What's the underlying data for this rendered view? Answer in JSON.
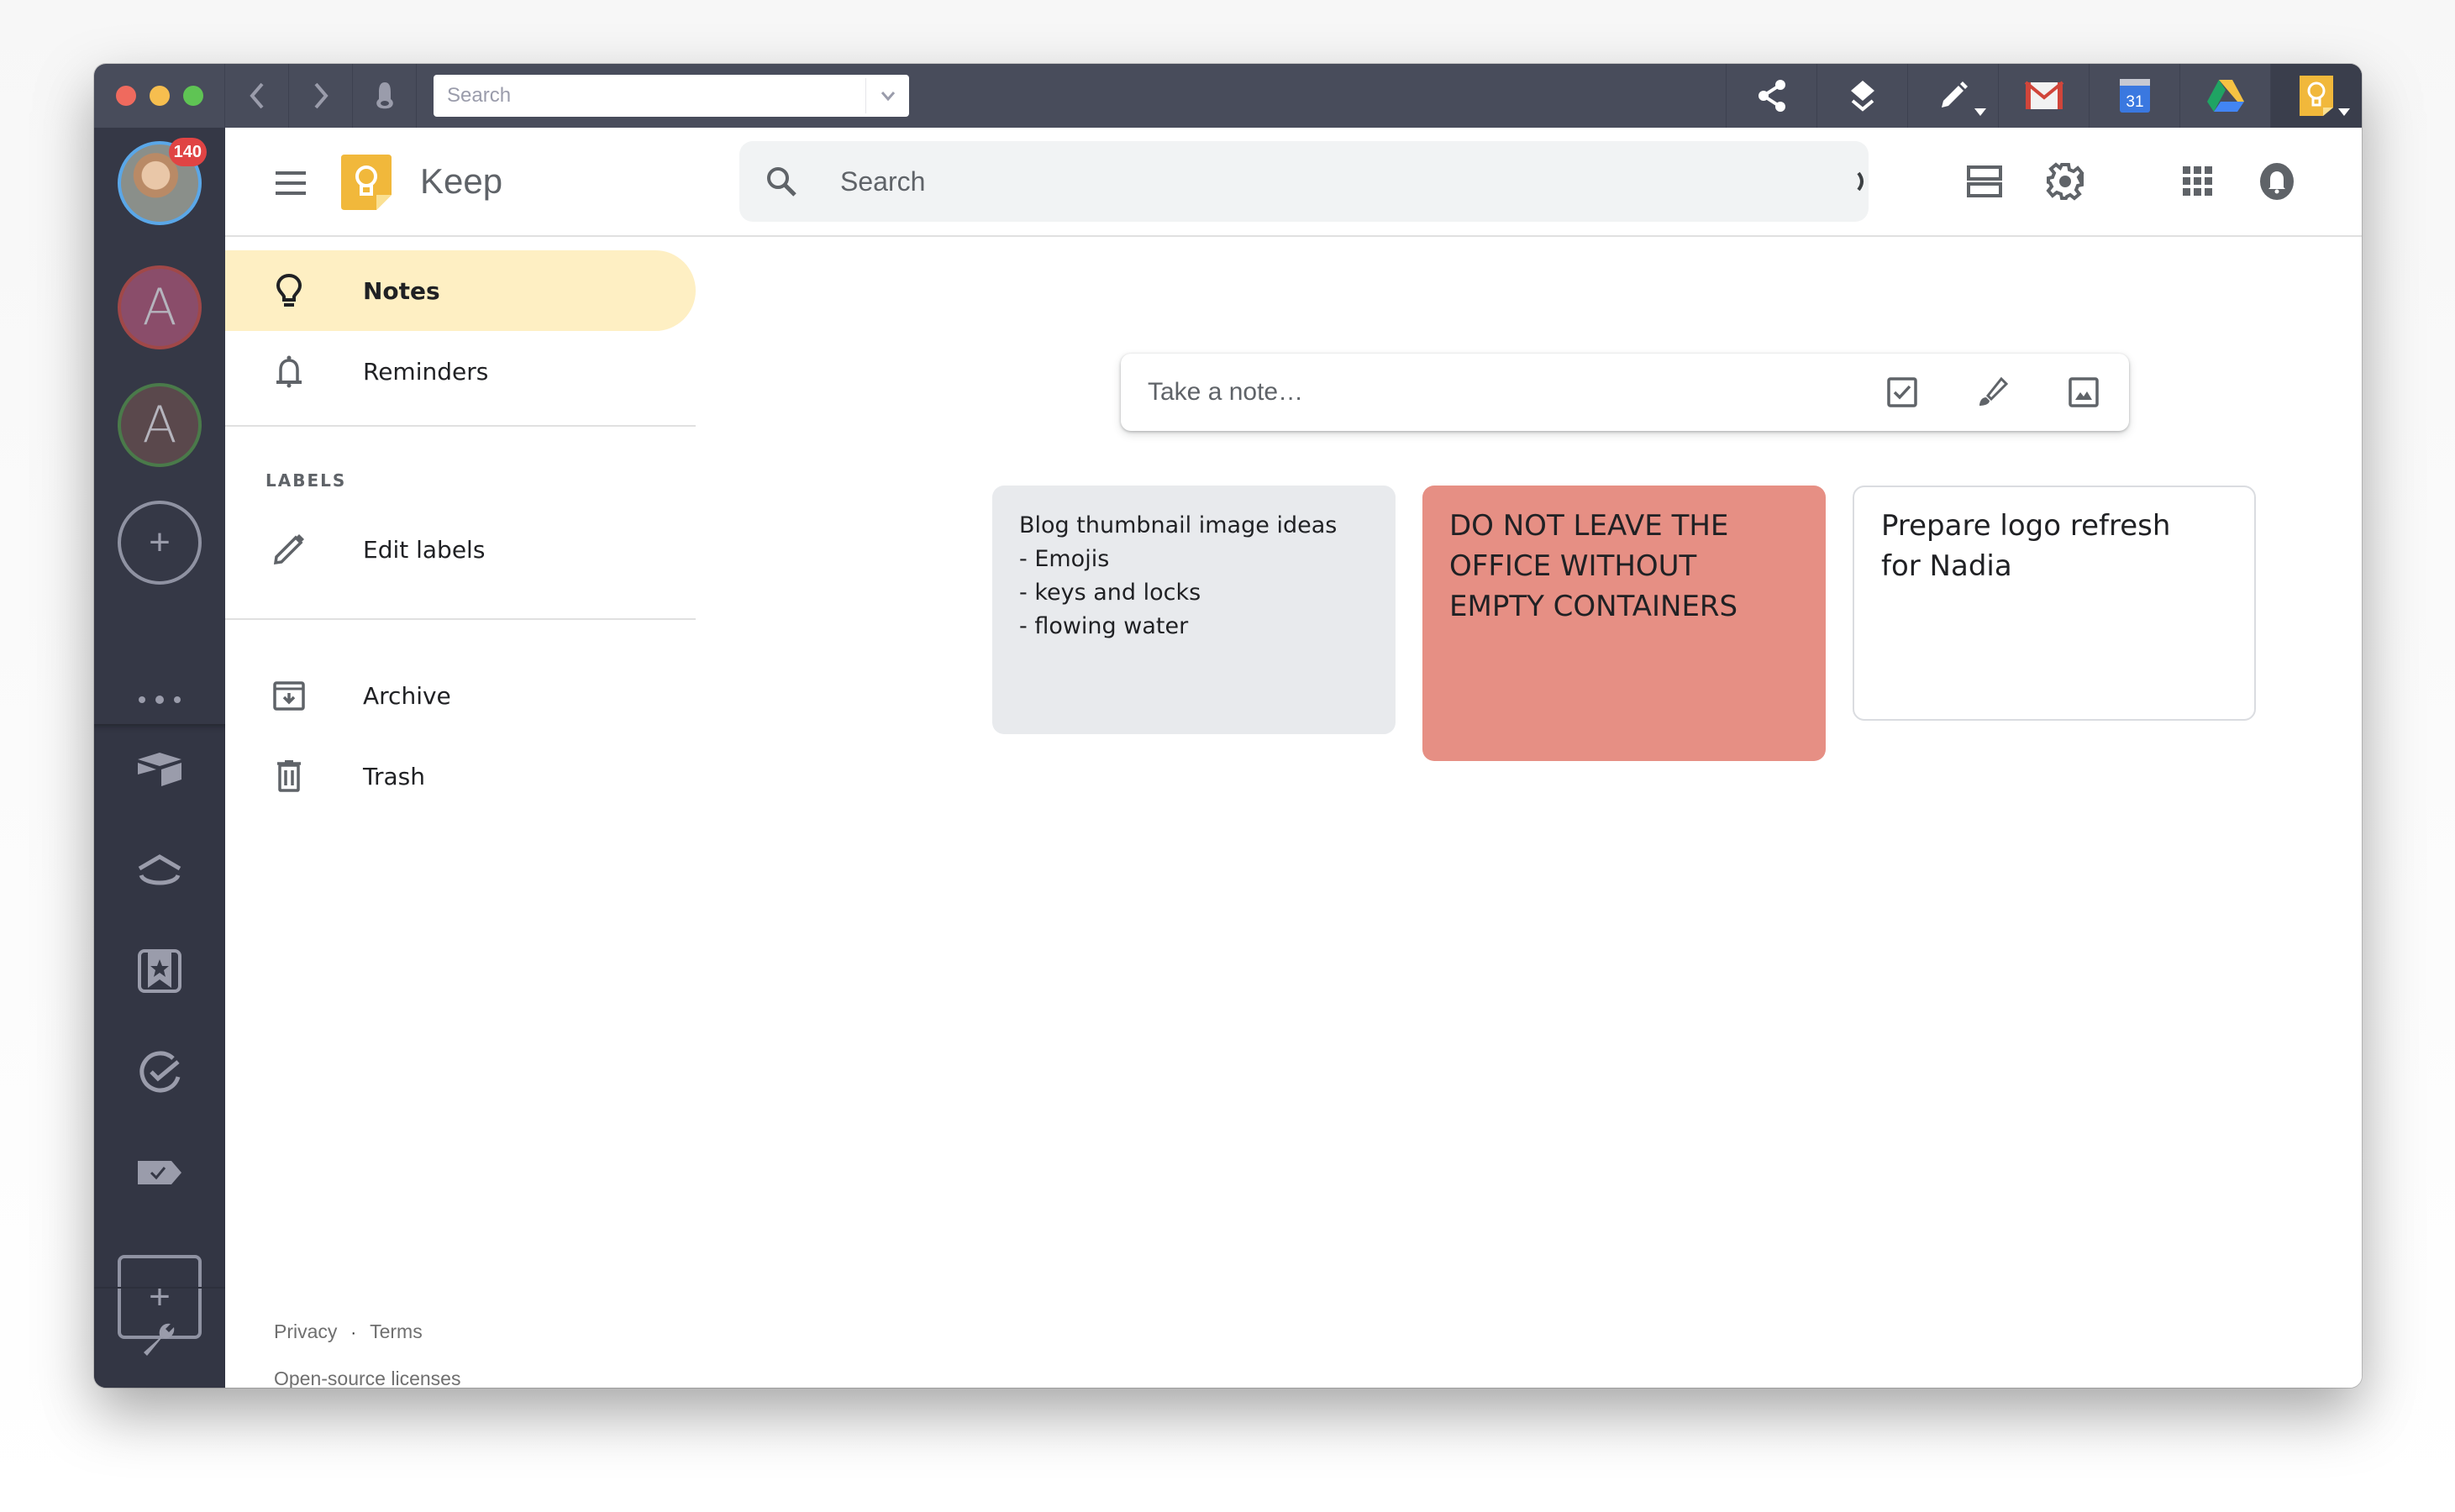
{
  "titlebar": {
    "search_placeholder": "Search",
    "apps": [
      {
        "name": "share",
        "icon": "share-icon"
      },
      {
        "name": "layers",
        "icon": "layers-icon"
      },
      {
        "name": "compose",
        "icon": "pencil-icon"
      },
      {
        "name": "Gmail",
        "icon": "gmail-icon"
      },
      {
        "name": "Google Calendar",
        "icon": "calendar-icon",
        "label": "31"
      },
      {
        "name": "Google Drive",
        "icon": "drive-icon"
      },
      {
        "name": "Google Keep",
        "icon": "keep-icon",
        "active": true
      }
    ]
  },
  "rail": {
    "primary_account_badge": "140",
    "accounts": [
      {
        "initial": "A",
        "color": "#8a4d6a",
        "ring": "#a04848"
      },
      {
        "initial": "A",
        "color": "#5a484c",
        "ring": "#4a7a4a"
      }
    ],
    "add_account_label": "+",
    "add_app_label": "+"
  },
  "header": {
    "app_title": "Keep",
    "search_placeholder": "Search"
  },
  "drawer": {
    "items": [
      {
        "label": "Notes",
        "icon": "lightbulb-icon",
        "active": true
      },
      {
        "label": "Reminders",
        "icon": "bell-icon"
      },
      {
        "label": "Edit labels",
        "icon": "pencil-icon"
      },
      {
        "label": "Archive",
        "icon": "archive-icon"
      },
      {
        "label": "Trash",
        "icon": "trash-icon"
      }
    ],
    "labels_heading": "LABELS",
    "footer": {
      "privacy": "Privacy",
      "separator": "·",
      "terms": "Terms",
      "licenses": "Open-source licenses"
    }
  },
  "composer": {
    "placeholder": "Take a note…"
  },
  "notes": [
    {
      "color": "#e8eaed",
      "lines": [
        "Blog thumbnail image ideas",
        "- Emojis",
        "- keys and locks",
        "- flowing water"
      ]
    },
    {
      "color": "#e68f84",
      "lines": [
        "DO NOT LEAVE THE",
        "OFFICE WITHOUT",
        "EMPTY CONTAINERS"
      ]
    },
    {
      "color": "#ffffff",
      "lines": [
        "Prepare logo refresh",
        "for Nadia"
      ]
    }
  ],
  "colors": {
    "titlebar": "#484c5b",
    "rail": "#353846",
    "active_nav": "#feefc3",
    "keep_yellow": "#f4b400"
  }
}
